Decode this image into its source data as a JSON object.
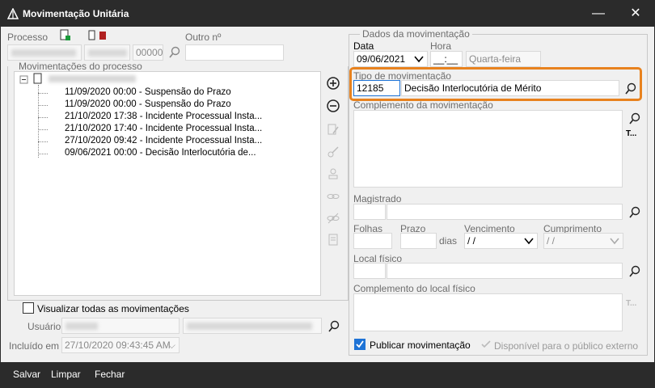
{
  "window": {
    "title": "Movimentação Unitária",
    "minimize": "—",
    "maximize": "☐",
    "close": "✕"
  },
  "left": {
    "processo_label": "Processo",
    "processo_num": "00000",
    "outro_label": "Outro nº",
    "movs_label": "Movimentações do processo",
    "movements": [
      "11/09/2020 00:00 - Suspensão do Prazo",
      "11/09/2020 00:00 - Suspensão do Prazo",
      "21/10/2020 17:38 - Incidente Processual Insta...",
      "21/10/2020 17:40 - Incidente Processual Insta...",
      "27/10/2020 09:42 - Incidente Processual Insta...",
      "09/06/2021 00:00 - Decisão Interlocutória de..."
    ],
    "view_all_label": "Visualizar todas as movimentações",
    "usuario_label": "Usuário",
    "incluido_label": "Incluído em",
    "incluido_value": "27/10/2020 09:43:45 AM"
  },
  "right": {
    "group_label": "Dados da movimentação",
    "data_label": "Data",
    "data_value": "09/06/2021",
    "hora_label": "Hora",
    "hora_value": "__:__",
    "weekday": "Quarta-feira",
    "tipo_label": "Tipo de movimentação",
    "tipo_code": "12185",
    "tipo_desc": "Decisão Interlocutória de Mérito",
    "complemento_label": "Complemento da movimentação",
    "magistrado_label": "Magistrado",
    "folhas_label": "Folhas",
    "prazo_label": "Prazo",
    "dias_label": "dias",
    "vencimento_label": "Vencimento",
    "vencimento_value": " / /",
    "cumprimento_label": "Cumprimento",
    "cumprimento_value": " / /",
    "local_label": "Local físico",
    "comp_local_label": "Complemento do local físico",
    "publicar_label": "Publicar movimentação",
    "disponivel_label": "Disponível para o público externo",
    "t_label": "T..."
  },
  "footer": {
    "salvar": "Salvar",
    "limpar": "Limpar",
    "fechar": "Fechar"
  },
  "colors": {
    "highlight": "#e8821e",
    "accent": "#1e73d6",
    "titlebar": "#2b2b2b"
  }
}
